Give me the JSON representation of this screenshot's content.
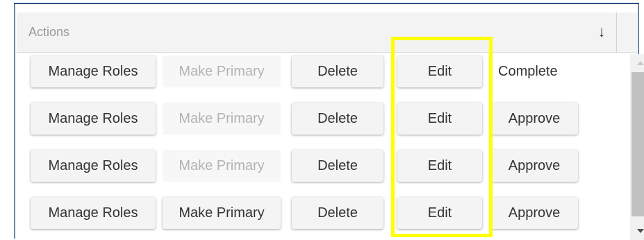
{
  "header": {
    "title": "Actions",
    "sort_icon": "sort-arrow-down-icon"
  },
  "rows": [
    {
      "manage_roles": "Manage Roles",
      "make_primary": "Make Primary",
      "make_primary_enabled": false,
      "delete": "Delete",
      "edit": "Edit",
      "status_action": "Complete",
      "status_action_is_button": false
    },
    {
      "manage_roles": "Manage Roles",
      "make_primary": "Make Primary",
      "make_primary_enabled": false,
      "delete": "Delete",
      "edit": "Edit",
      "status_action": "Approve",
      "status_action_is_button": true
    },
    {
      "manage_roles": "Manage Roles",
      "make_primary": "Make Primary",
      "make_primary_enabled": false,
      "delete": "Delete",
      "edit": "Edit",
      "status_action": "Approve",
      "status_action_is_button": true
    },
    {
      "manage_roles": "Manage Roles",
      "make_primary": "Make Primary",
      "make_primary_enabled": true,
      "delete": "Delete",
      "edit": "Edit",
      "status_action": "Approve",
      "status_action_is_button": true
    }
  ],
  "colors": {
    "highlight": "#ffff00",
    "header_bg": "#f3f3f3",
    "disabled_text": "#b3b3b3"
  }
}
